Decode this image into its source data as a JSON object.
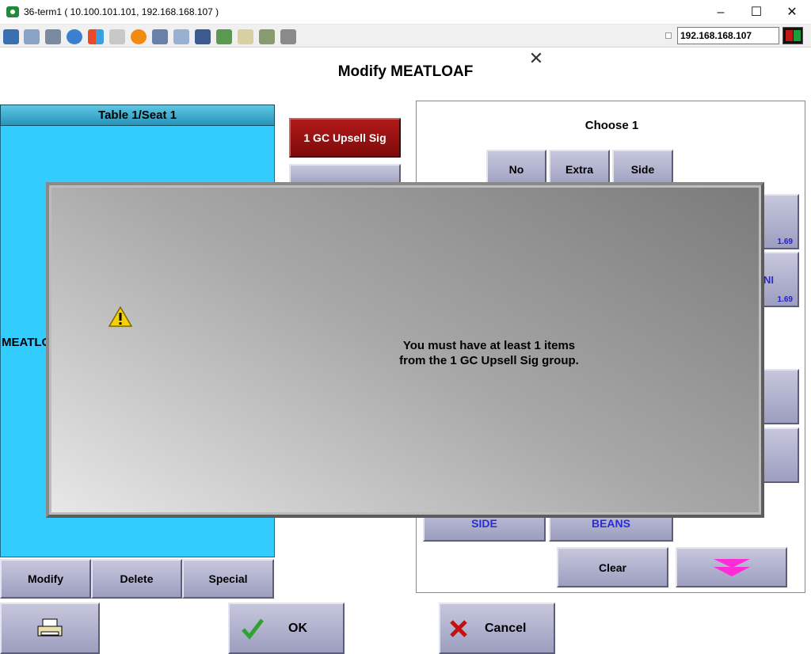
{
  "window": {
    "title": "36-term1 ( 10.100.101.101, 192.168.168.107 )",
    "minimize": "–",
    "maximize": "☐",
    "close": "✕"
  },
  "toolbar": {
    "ip_address": "192.168.168.107",
    "icons": [
      "monitor-icon",
      "windows-icon",
      "tools-icon",
      "refresh-icon",
      "flag-icon",
      "keyboard-icon",
      "alert-icon",
      "network-icon",
      "fullscreen-icon",
      "screen-icon",
      "transfer-icon",
      "file-icon",
      "scale-icon",
      "copy-icon"
    ]
  },
  "dialog": {
    "title": "Modify MEATLOAF",
    "close_glyph": "✕"
  },
  "seat_panel": {
    "header": "Table 1/Seat 1",
    "item": "MEATLOAF",
    "buttons": {
      "modify": "Modify",
      "delete": "Delete",
      "special": "Special"
    }
  },
  "group_buttons": {
    "upsell": "1 GC Upsell Sig"
  },
  "modifier_panel": {
    "choose_label": "Choose 1",
    "prefix_buttons": {
      "no": "No",
      "extra": "Extra",
      "side": "Side"
    },
    "prices": {
      "first": "1.69",
      "second": "1.69"
    },
    "partial_label": "NI",
    "bottom_items": {
      "side": "SIDE",
      "beans": "BEANS"
    },
    "clear": "Clear",
    "scroll_down": "scroll-down"
  },
  "footer": {
    "print_icon": "printer-icon",
    "ok": "OK",
    "cancel": "Cancel"
  },
  "message": {
    "line1": "You must have at least 1 items",
    "line2": "from the 1 GC Upsell Sig group.",
    "icon": "warning-icon"
  },
  "colors": {
    "seat_panel": "#33ccff",
    "button_face": "#b5b6d0",
    "upsell_button": "#9a1010",
    "scroll_arrow": "#ff2bd6"
  }
}
